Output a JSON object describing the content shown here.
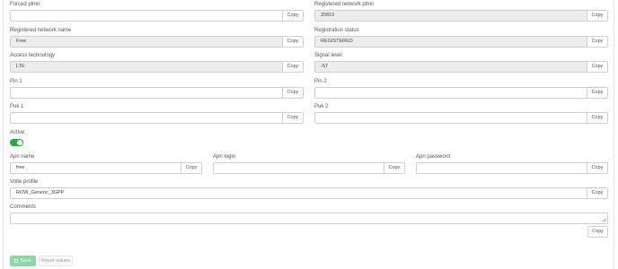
{
  "fields": {
    "forced_plmn": {
      "label": "Forced plmn",
      "value": "",
      "copy": "Copy"
    },
    "registered_network_plmn": {
      "label": "Registered network plmn",
      "value": "20815",
      "copy": "Copy"
    },
    "registered_network_name": {
      "label": "Registered network name",
      "value": "Free",
      "copy": "Copy"
    },
    "registration_status": {
      "label": "Registration status",
      "value": "REGISTERED",
      "copy": "Copy"
    },
    "access_technology": {
      "label": "Access technology",
      "value": "LTE",
      "copy": "Copy"
    },
    "signal_level": {
      "label": "Signal level",
      "value": "-57",
      "copy": "Copy"
    },
    "pin1": {
      "label": "Pin 1",
      "value": "",
      "copy": "Copy"
    },
    "pin2": {
      "label": "Pin 2",
      "value": "",
      "copy": "Copy"
    },
    "puk1": {
      "label": "Puk 1",
      "value": "",
      "copy": "Copy"
    },
    "puk2": {
      "label": "Puk 2",
      "value": "",
      "copy": "Copy"
    },
    "active": {
      "label": "Active",
      "on": true
    },
    "apn_name": {
      "label": "Apn name",
      "value": "free",
      "copy": "Copy"
    },
    "apn_login": {
      "label": "Apn login",
      "value": "",
      "copy": "Copy"
    },
    "apn_password": {
      "label": "Apn password",
      "value": "",
      "copy": "Copy"
    },
    "volte_profile": {
      "label": "Volte profile",
      "value": "ROW_Generic_3GPP",
      "copy": "Copy"
    },
    "comments": {
      "label": "Comments",
      "value": "",
      "copy": "Copy"
    }
  },
  "actions": {
    "save": "Save",
    "reset": "Reset values"
  },
  "icons": {
    "save": "floppy-disk-icon",
    "resize": "resize-grip-icon"
  },
  "colors": {
    "toggle_on": "#28a745",
    "save_button": "#8fd6a3"
  }
}
